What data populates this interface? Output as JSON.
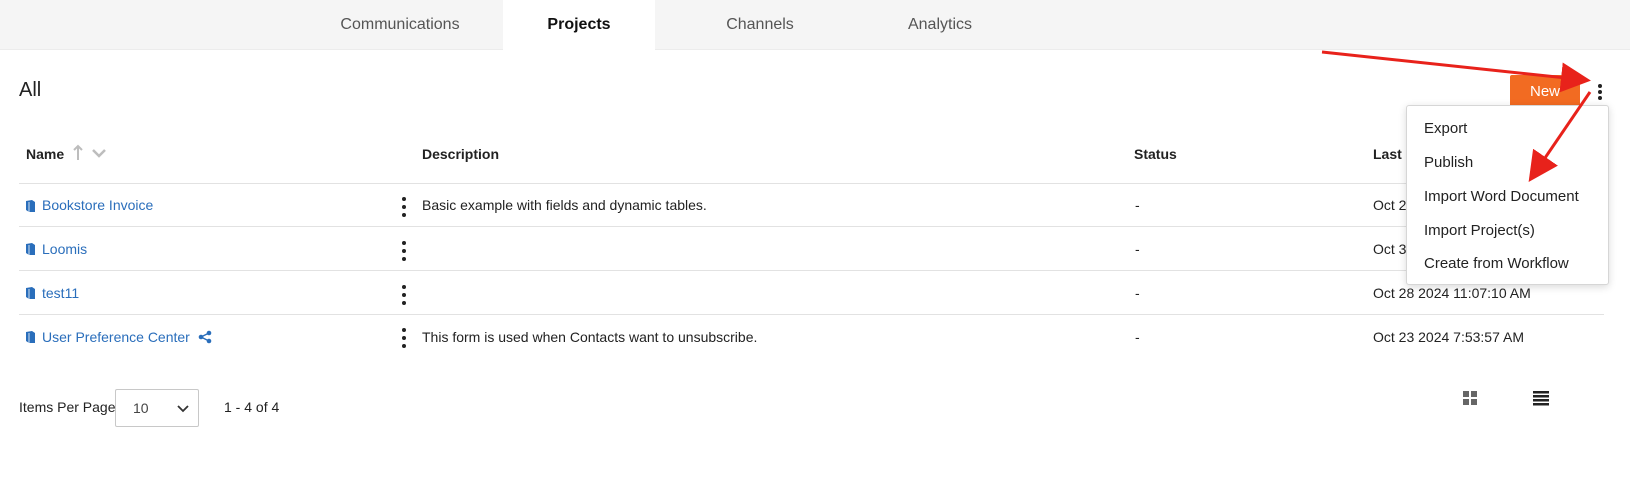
{
  "tabs": [
    {
      "label": "Communications",
      "active": false
    },
    {
      "label": "Projects",
      "active": true
    },
    {
      "label": "Channels",
      "active": false
    },
    {
      "label": "Analytics",
      "active": false
    }
  ],
  "page": {
    "title": "All"
  },
  "toolbar": {
    "new_label": "New"
  },
  "table": {
    "headers": {
      "name": "Name",
      "description": "Description",
      "status": "Status",
      "last_modified": "Last M"
    },
    "rows": [
      {
        "name": "Bookstore Invoice",
        "description": "Basic example with fields and dynamic tables.",
        "status": "-",
        "last_modified": "Oct 2",
        "shared": false
      },
      {
        "name": "Loomis",
        "description": "",
        "status": "-",
        "last_modified": "Oct 3",
        "shared": false
      },
      {
        "name": "test11",
        "description": "",
        "status": "-",
        "last_modified": "Oct 28 2024 11:07:10 AM",
        "shared": false
      },
      {
        "name": "User Preference Center",
        "description": "This form is used when Contacts want to unsubscribe.",
        "status": "-",
        "last_modified": "Oct 23 2024 7:53:57 AM",
        "shared": true
      }
    ]
  },
  "menu": {
    "items": [
      "Export",
      "Publish",
      "Import Word Document",
      "Import Project(s)",
      "Create from Workflow"
    ]
  },
  "pagination": {
    "items_per_page_label": "Items Per Page",
    "items_per_page_value": "10",
    "range": "1 - 4 of 4"
  },
  "colors": {
    "accent": "#f26b22",
    "link": "#2a6ebb",
    "annotation_arrow": "#e8221b"
  },
  "icons": [
    "sort-up-arrow-icon",
    "chevron-down-icon",
    "document-icon",
    "share-icon",
    "kebab-menu-icon",
    "grid-view-icon",
    "list-view-icon"
  ]
}
